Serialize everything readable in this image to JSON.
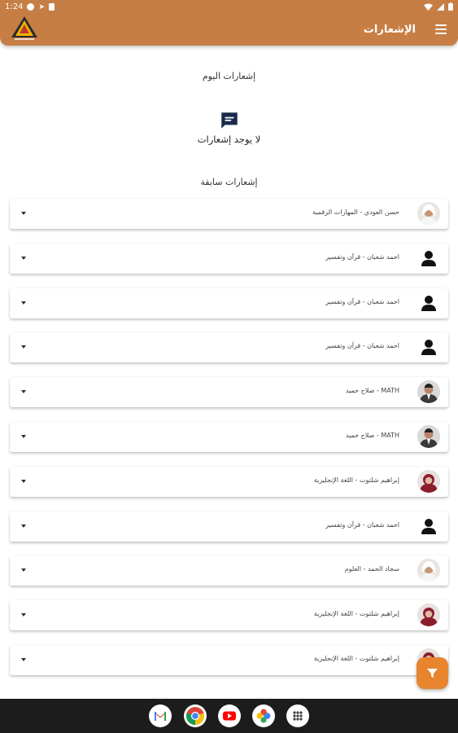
{
  "status_bar": {
    "time": "1:24"
  },
  "app_bar": {
    "title": "الإشعارات",
    "logo_icon": "triangle-logo-icon",
    "menu_icon": "hamburger-menu-icon"
  },
  "today": {
    "heading": "إشعارات اليوم",
    "empty_message": "لا يوجد إشعارات",
    "empty_icon": "chat-bubble-icon"
  },
  "previous": {
    "heading": "إشعارات سابقة",
    "items": [
      {
        "label": "حسن العودي - المهارات الرقمية",
        "avatar": "photo-man-white-headscarf"
      },
      {
        "label": "احمد شعبان - قرآن وتفسير",
        "avatar": "generic-person-icon"
      },
      {
        "label": "احمد شعبان - قرآن وتفسير",
        "avatar": "generic-person-icon"
      },
      {
        "label": "احمد شعبان - قرآن وتفسير",
        "avatar": "generic-person-icon"
      },
      {
        "label": "MATH - صلاح حميد",
        "avatar": "photo-man-suit"
      },
      {
        "label": "MATH - صلاح حميد",
        "avatar": "photo-man-suit"
      },
      {
        "label": "إبراهيم شلتوت - اللغة الإنجليزية",
        "avatar": "photo-woman-red"
      },
      {
        "label": "احمد شعبان - قرآن وتفسير",
        "avatar": "generic-person-icon"
      },
      {
        "label": "سجاد الحمد - العلوم",
        "avatar": "photo-man-white-headscarf"
      },
      {
        "label": "إبراهيم شلتوت - اللغة الإنجليزية",
        "avatar": "photo-woman-red"
      },
      {
        "label": "إبراهيم شلتوت - اللغة الإنجليزية",
        "avatar": "photo-woman-red"
      }
    ]
  },
  "fab": {
    "icon": "filter-icon"
  },
  "dock": {
    "apps": [
      "gmail-icon",
      "chrome-icon",
      "youtube-icon",
      "photos-icon",
      "app-drawer-icon"
    ]
  },
  "colors": {
    "brand": "#c77e44",
    "fab": "#e8842e",
    "navbar": "#1c1c1c"
  }
}
